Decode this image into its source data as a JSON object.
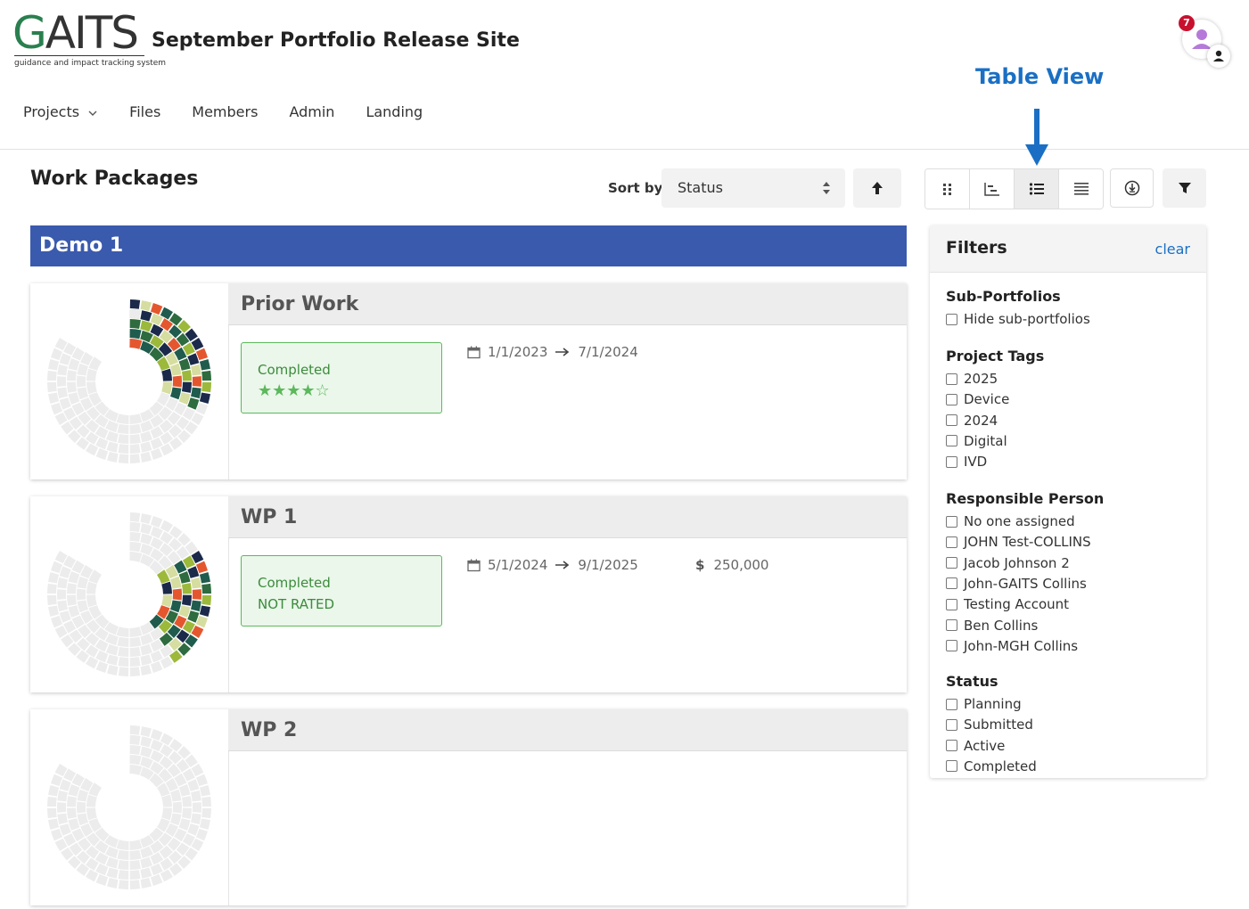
{
  "brand": {
    "logo_text_g": "G",
    "logo_text_rest": "AITS",
    "logo_tagline": "guidance and impact tracking system",
    "site_title": "September Portfolio Release Site"
  },
  "user": {
    "notification_count": "7"
  },
  "nav": {
    "items": [
      "Projects",
      "Files",
      "Members",
      "Admin",
      "Landing"
    ]
  },
  "annotation": {
    "label": "Table View"
  },
  "page": {
    "title": "Work Packages"
  },
  "sort": {
    "label": "Sort by",
    "selected": "Status"
  },
  "group": {
    "name": "Demo 1"
  },
  "work_packages": [
    {
      "title": "Prior Work",
      "status_line1": "Completed",
      "status_line2": "★★★★☆",
      "start": "1/1/2023",
      "end": "7/1/2024",
      "budget": ""
    },
    {
      "title": "WP 1",
      "status_line1": "Completed",
      "status_line2": "NOT RATED",
      "start": "5/1/2024",
      "end": "9/1/2025",
      "budget": "250,000"
    },
    {
      "title": "WP 2",
      "status_line1": "",
      "status_line2": "",
      "start": "",
      "end": "",
      "budget": ""
    }
  ],
  "filters": {
    "title": "Filters",
    "clear_label": "clear",
    "sections": [
      {
        "heading": "Sub-Portfolios",
        "options": [
          "Hide sub-portfolios"
        ]
      },
      {
        "heading": "Project Tags",
        "options": [
          "2025",
          "Device",
          "2024",
          "Digital",
          "IVD"
        ]
      },
      {
        "heading": "Responsible Person",
        "options": [
          "No one assigned",
          "JOHN Test-COLLINS",
          "Jacob Johnson 2",
          "John-GAITS Collins",
          "Testing Account",
          "Ben Collins",
          "John-MGH Collins"
        ]
      },
      {
        "heading": "Status",
        "options": [
          "Planning",
          "Submitted",
          "Active",
          "Completed"
        ]
      }
    ]
  },
  "colors": {
    "accent_blue": "#1a6fc4",
    "group_header": "#3a5aad",
    "status_green": "#5cb85c",
    "badge_red": "#c8102e"
  },
  "icons": {
    "view_buttons": [
      "grid-view-icon",
      "gantt-view-icon",
      "list-view-icon",
      "table-view-icon"
    ],
    "download": "download-icon",
    "filter": "filter-funnel-icon"
  }
}
